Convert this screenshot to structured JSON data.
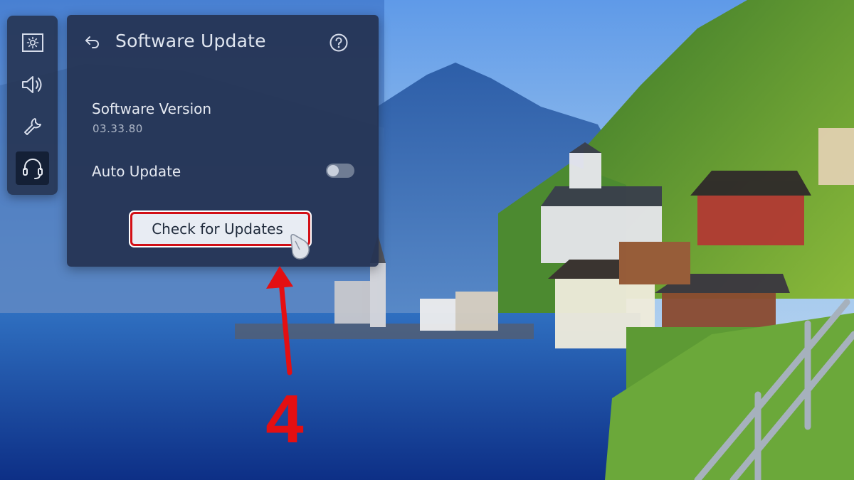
{
  "colors": {
    "panel_bg": "#253352",
    "button_bg": "#e8ecf3",
    "highlight_red": "#d20f16"
  },
  "icon_rail": {
    "items": [
      {
        "icon": "picture-settings-icon",
        "active": false
      },
      {
        "icon": "sound-icon",
        "active": false
      },
      {
        "icon": "general-wrench-icon",
        "active": false
      },
      {
        "icon": "support-headset-icon",
        "active": true
      }
    ]
  },
  "panel": {
    "back_icon": "back-arrow-icon",
    "title": "Software Update",
    "help_icon": "help-icon",
    "software_version": {
      "label": "Software Version",
      "value": "03.33.80"
    },
    "auto_update": {
      "label": "Auto Update",
      "enabled": false
    },
    "check_button": {
      "label": "Check for Updates"
    }
  },
  "annotation": {
    "step": "4"
  }
}
